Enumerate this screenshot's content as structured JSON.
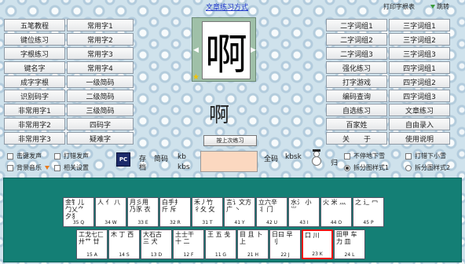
{
  "header": {
    "title": "文章练习方式",
    "print": "打印字根表",
    "skip": "跳转"
  },
  "left_buttons": [
    [
      "五笔教程",
      "常用字1"
    ],
    [
      "键位练习",
      "常用字2"
    ],
    [
      "字根练习",
      "常用字3"
    ],
    [
      "键名字",
      "常用字4"
    ],
    [
      "成字字根",
      "一级简码"
    ],
    [
      "识别码字",
      "二级简码"
    ],
    [
      "非常用字1",
      "三级简码"
    ],
    [
      "非常用字2",
      "四码字"
    ],
    [
      "非常用字3",
      "疑难字"
    ]
  ],
  "right_buttons": [
    [
      "二字词组1",
      "三字词组1"
    ],
    [
      "二字词组2",
      "三字词组2"
    ],
    [
      "二字词组3",
      "三字词组3"
    ],
    [
      "强化练习",
      "四字词组1"
    ],
    [
      "打字游戏",
      "四字词组2"
    ],
    [
      "编码查询",
      "四字词组3"
    ],
    [
      "自选练习",
      "文章练习"
    ],
    [
      "百家姓",
      "自由录入"
    ],
    [
      "关　　于",
      "使用说明"
    ]
  ],
  "glyph": {
    "char": "啊",
    "big_char": "啊"
  },
  "prev_button": "按上次练习",
  "options_left": [
    {
      "label": "击键发声",
      "checked": false
    },
    {
      "label": "打错发声",
      "checked": false
    },
    {
      "label": "背景音乐",
      "checked": false
    },
    {
      "label": "相关设置",
      "checked": false
    }
  ],
  "stats": {
    "jianma": "简码",
    "kb": "kb",
    "kbs": "kbs",
    "quanma": "全码",
    "kbsk": "kbsk",
    "pc_char_top": "存",
    "pc_char_bottom": "档",
    "gui": "归"
  },
  "options_right": [
    {
      "label": "不停地下雪",
      "checked": false
    },
    {
      "label": "打错下小雪",
      "checked": false
    },
    {
      "label": "拆分图样式1",
      "checked": true
    },
    {
      "label": "拆分图样式2",
      "checked": false
    }
  ],
  "keys_row1": [
    {
      "roots": "金钅儿 勹乂⺈ 夕犭",
      "code": "35 Q"
    },
    {
      "roots": "人 亻 八",
      "code": "34 W"
    },
    {
      "roots": "月彡用 乃豕 衣",
      "code": "33 E"
    },
    {
      "roots": "白手扌 斤 斥",
      "code": "32 R"
    },
    {
      "roots": "禾丿竹 彳夂 攵",
      "code": "31 T"
    },
    {
      "roots": "言讠文方 广 丶",
      "code": "41 Y"
    },
    {
      "roots": "立六辛 丬 门",
      "code": "42 U"
    },
    {
      "roots": "水氵 小⺌",
      "code": "43 I"
    },
    {
      "roots": "火 米 灬",
      "code": "44 O"
    },
    {
      "roots": "之 辶 冖",
      "code": "45 P"
    }
  ],
  "keys_row2": [
    {
      "roots": "工戈七匚 廾艹 廿",
      "code": "15 A"
    },
    {
      "roots": "木 丁 西",
      "code": "14 S"
    },
    {
      "roots": "大石古 三 犬",
      "code": "13 D"
    },
    {
      "roots": "土士干 十 二",
      "code": "12 F"
    },
    {
      "roots": "王 五 戋",
      "code": "11 G"
    },
    {
      "roots": "目 且 卜 上",
      "code": "21 H"
    },
    {
      "roots": "日曰 早 刂",
      "code": "22 J"
    },
    {
      "roots": "口 川",
      "code": "23 K"
    },
    {
      "roots": "田甲 车力 皿",
      "code": "24 L"
    }
  ],
  "colors": {
    "keyboard_bg": "#147f75",
    "active_key_border": "#ee1111",
    "input_bg": "#fbd8c0"
  }
}
